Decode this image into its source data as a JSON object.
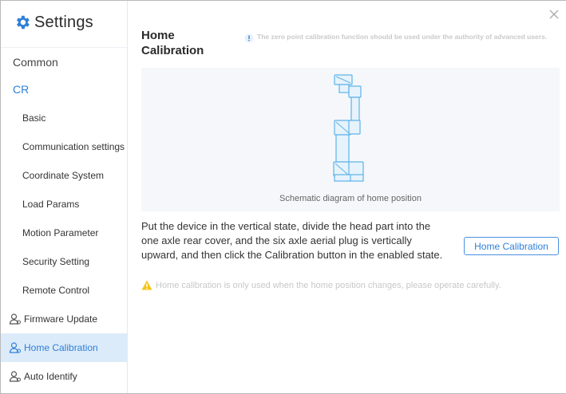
{
  "sidebar": {
    "title": "Settings",
    "items": [
      {
        "label": "Common"
      },
      {
        "label": "CR"
      },
      {
        "label": "Basic"
      },
      {
        "label": "Communication settings"
      },
      {
        "label": "Coordinate System"
      },
      {
        "label": "Load Params"
      },
      {
        "label": "Motion Parameter"
      },
      {
        "label": "Security Setting"
      },
      {
        "label": "Remote Control"
      },
      {
        "label": "Firmware Update",
        "icon": "user-icon"
      },
      {
        "label": "Home Calibration",
        "icon": "user-icon",
        "active": true
      },
      {
        "label": "Auto Identify",
        "icon": "user-icon"
      }
    ]
  },
  "main": {
    "title": "Home Calibration",
    "note": "The zero point calibration function should be used under the authority of advanced users.",
    "diagram_caption": "Schematic diagram of home position",
    "instruction": "Put the device in the vertical state, divide the head part into the one axle rear cover, and the six axle aerial plug is vertically upward, and then click the Calibration button in the enabled state.",
    "button_label": "Home Calibration",
    "caution": "Home calibration is only used when the home position changes, please operate carefully."
  },
  "colors": {
    "accent": "#2f7fd8",
    "active_bg": "#dcebf9",
    "warning": "#f5c518"
  }
}
